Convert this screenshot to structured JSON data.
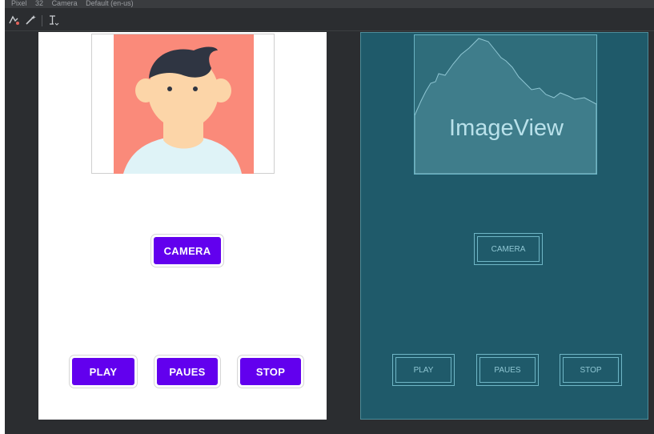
{
  "topbar": {
    "items": [
      "Pixel",
      "32",
      "Camera",
      "Default (en-us)"
    ]
  },
  "design": {
    "buttons": {
      "camera": "CAMERA",
      "play": "PLAY",
      "pause": "PAUES",
      "stop": "STOP"
    }
  },
  "blueprint": {
    "image_label": "ImageView",
    "buttons": {
      "camera": "CAMERA",
      "play": "PLAY",
      "pause": "PAUES",
      "stop": "STOP"
    }
  },
  "colors": {
    "accent": "#6200ee",
    "blueprint_bg": "#1f5a6a",
    "avatar_bg": "#fa8a7a"
  },
  "icons": [
    "design-toggle-icon",
    "magic-wand-icon",
    "text-cursor-icon"
  ]
}
